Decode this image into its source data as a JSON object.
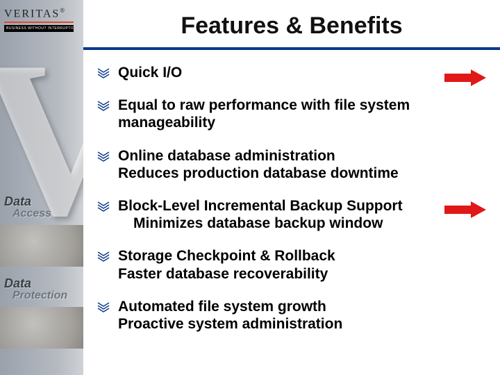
{
  "brand": {
    "name": "VERITAS",
    "reg": "®",
    "tagline": "BUSINESS WITHOUT INTERRUPTION"
  },
  "sidebar": {
    "label1_a": "Data",
    "label1_b": "Access",
    "label2_a": "Data",
    "label2_b": "Protection"
  },
  "title": "Features & Benefits",
  "bullets": [
    {
      "line1": "Quick I/O",
      "line2": "",
      "indent": false
    },
    {
      "line1": "Equal to raw performance with file system",
      "line2": "manageability",
      "indent": false
    },
    {
      "line1": "Online database administration",
      "line2": "Reduces production database downtime",
      "indent": false
    },
    {
      "line1": "Block-Level Incremental Backup Support",
      "line2": "Minimizes database backup window",
      "indent": true
    },
    {
      "line1": "Storage Checkpoint & Rollback",
      "line2": "Faster database recoverability",
      "indent": false
    },
    {
      "line1": "Automated file system growth",
      "line2": "Proactive system administration",
      "indent": false
    }
  ],
  "colors": {
    "title_rule": "#0b3a8a",
    "logo_rule": "#e04a2a",
    "arrow_fill": "#e11818"
  }
}
